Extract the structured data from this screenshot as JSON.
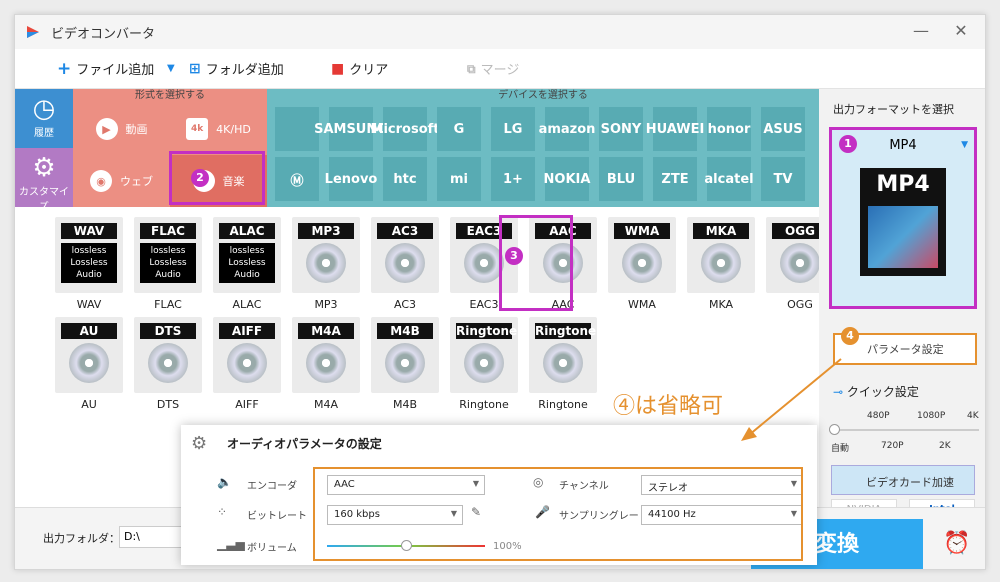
{
  "window": {
    "title": "ビデオコンバータ",
    "minimize": "—",
    "close": "✕"
  },
  "toolbar": {
    "add_file": "ファイル追加",
    "add_folder": "フォルダ追加",
    "clear": "クリア",
    "merge": "マージ"
  },
  "left_nav": {
    "history": "履歴",
    "custom": "カスタマイズ"
  },
  "format_select": {
    "header": "形式を選択する",
    "video": "動画",
    "fourk": "4K/HD",
    "web": "ウェブ",
    "music": "音楽"
  },
  "device_select": {
    "header": "デバイスを選択する",
    "row1": [
      "",
      "SAMSUNG",
      "Microsoft",
      "G",
      "LG",
      "amazon",
      "SONY",
      "HUAWEI",
      "honor",
      "ASUS"
    ],
    "row2": [
      "",
      "Lenovo",
      "htc",
      "mi",
      "1+",
      "NOKIA",
      "BLU",
      "ZTE",
      "alcatel",
      "TV"
    ]
  },
  "codecs": {
    "row1": [
      "WAV",
      "FLAC",
      "ALAC",
      "MP3",
      "AC3",
      "EAC3",
      "AAC",
      "WMA",
      "MKA",
      "OGG"
    ],
    "row2": [
      "AU",
      "DTS",
      "AIFF",
      "M4A",
      "M4B",
      "Ringtone",
      "Ringtone"
    ],
    "lossless_text": "lossless Lossless Audio"
  },
  "output_panel": {
    "header": "出力フォーマットを選択",
    "format": "MP4",
    "format_thumb": "MP4",
    "param_button": "パラメータ設定",
    "quick": "クイック設定",
    "ticks_top": [
      "480P",
      "1080P",
      "4K"
    ],
    "ticks_bottom": [
      "自動",
      "720P",
      "2K"
    ],
    "gpu": "ビデオカード加速",
    "nvidia": "NVIDIA",
    "intel": "Intel"
  },
  "bottom": {
    "output_folder_label": "出力フォルダ：",
    "output_folder_value": "D:\\",
    "convert": "変換"
  },
  "audio_dialog": {
    "title": "オーディオパラメータの設定",
    "encoder_label": "エンコーダ",
    "encoder_value": "AAC",
    "bitrate_label": "ビットレート",
    "bitrate_value": "160 kbps",
    "volume_label": "ボリューム",
    "volume_value": "100%",
    "channel_label": "チャンネル",
    "channel_value": "ステレオ",
    "sample_label": "サンプリングレート",
    "sample_value": "44100 Hz"
  },
  "annotations": {
    "n1": "1",
    "n2": "2",
    "n3": "3",
    "n4": "4",
    "note": "④は省略可"
  },
  "colors": {
    "format_bg": "#ec8f83",
    "device_bg": "#6dbcc3",
    "highlight": "#c32fc3",
    "orange": "#e5912f",
    "convert": "#2fa9f0"
  }
}
